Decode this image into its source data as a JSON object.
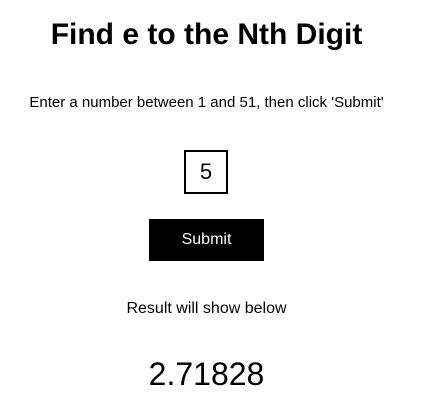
{
  "header": {
    "title": "Find e to the Nth Digit"
  },
  "form": {
    "instructions": "Enter a number between 1 and 51, then click 'Submit'",
    "digit_input_value": "5",
    "submit_label": "Submit"
  },
  "result": {
    "label": "Result will show below",
    "value": "2.71828"
  },
  "colors": {
    "background": "#ffffff",
    "text": "#000000",
    "button_background": "#000000",
    "button_text": "#ffffff"
  }
}
